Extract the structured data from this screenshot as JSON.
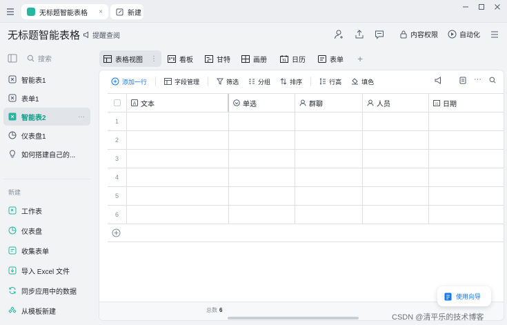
{
  "browser": {
    "active_tab": "无标题智能表格",
    "new_tab": "新建",
    "close_glyph": "×"
  },
  "header": {
    "title": "无标题智能表格",
    "remind": "提醒查阅",
    "permission": "内容权限",
    "automation": "自动化"
  },
  "sidebar": {
    "search_placeholder": "搜索",
    "items": [
      {
        "label": "智能表1",
        "icon": "smartsheet-icon"
      },
      {
        "label": "表单1",
        "icon": "form-icon"
      },
      {
        "label": "智能表2",
        "icon": "smartsheet-icon",
        "active": true,
        "more": "···"
      },
      {
        "label": "仪表盘1",
        "icon": "dashboard-icon"
      },
      {
        "label": "如何搭建自己的...",
        "icon": "lightbulb-icon"
      }
    ],
    "section_title": "新建",
    "new_items": [
      {
        "label": "工作表",
        "icon": "add-sheet-icon"
      },
      {
        "label": "仪表盘",
        "icon": "add-dashboard-icon"
      },
      {
        "label": "收集表单",
        "icon": "add-form-icon"
      },
      {
        "label": "导入 Excel 文件",
        "icon": "import-icon"
      },
      {
        "label": "同步应用中的数据",
        "icon": "sync-icon"
      },
      {
        "label": "从模板新建",
        "icon": "template-icon"
      }
    ]
  },
  "views": {
    "tabs": [
      {
        "label": "表格视图",
        "active": true
      },
      {
        "label": "看板"
      },
      {
        "label": "甘特"
      },
      {
        "label": "画册"
      },
      {
        "label": "日历"
      },
      {
        "label": "表单"
      }
    ],
    "more": "⋮",
    "add": "+"
  },
  "toolbar": {
    "add_row": "添加一行",
    "fields": "字段管理",
    "filter": "筛选",
    "group": "分组",
    "sort": "排序",
    "row_height": "行高",
    "fill": "填色",
    "more": "···"
  },
  "table": {
    "columns": [
      {
        "label": "文本",
        "icon": "text-field-icon"
      },
      {
        "label": "单选",
        "icon": "single-select-icon"
      },
      {
        "label": "群聊",
        "icon": "group-chat-icon"
      },
      {
        "label": "人员",
        "icon": "person-icon"
      },
      {
        "label": "日期",
        "icon": "date-icon"
      }
    ],
    "rows": [
      "1",
      "2",
      "3",
      "4",
      "5",
      "6"
    ]
  },
  "footer": {
    "total_label": "总数",
    "total_value": "6"
  },
  "guide_button": "使用向导",
  "watermark": "CSDN @清平乐的技术博客",
  "colors": {
    "accent": "#1677ff",
    "brand": "#26b5a1",
    "active_sheet": "#0f9e8a"
  }
}
